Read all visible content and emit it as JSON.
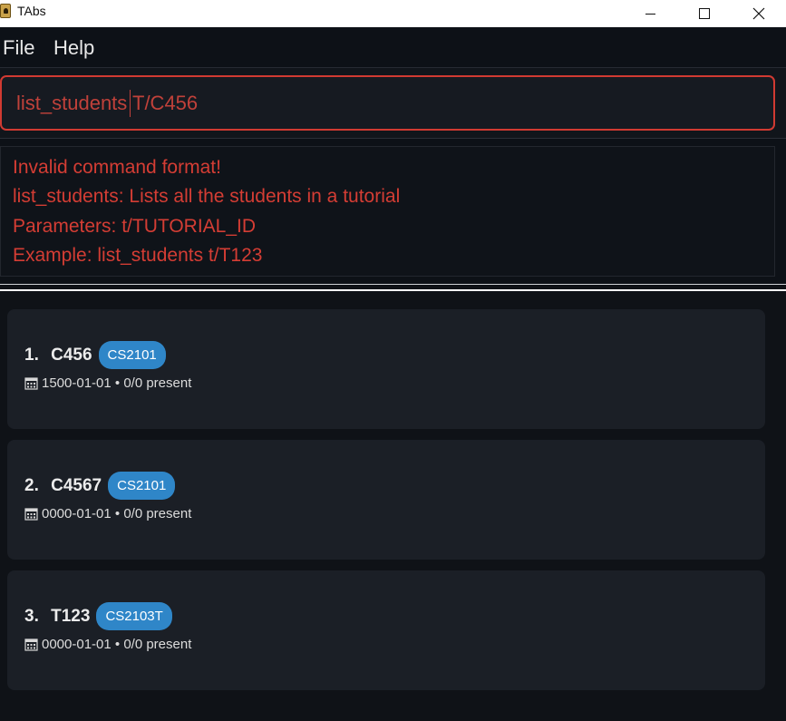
{
  "window": {
    "title": "TAbs"
  },
  "menu": {
    "file": "File",
    "help": "Help"
  },
  "command": {
    "value": "list_students T/C456"
  },
  "result": {
    "lines": [
      "Invalid command format!",
      "list_students: Lists all the students in a tutorial",
      "Parameters: t/TUTORIAL_ID",
      "Example: list_students t/T123"
    ]
  },
  "tutorials": [
    {
      "index": "1. ",
      "id": "C456",
      "tag": "CS2101",
      "meta": "1500-01-01 • 0/0 present"
    },
    {
      "index": "2. ",
      "id": "C4567",
      "tag": "CS2101",
      "meta": "0000-01-01 • 0/0 present"
    },
    {
      "index": "3. ",
      "id": "T123",
      "tag": "CS2103T",
      "meta": "0000-01-01 • 0/0 present"
    }
  ],
  "icons": {
    "app": "app-icon",
    "calendar": "calendar-icon"
  },
  "colors": {
    "error": "#d43d34",
    "tag": "#2f86c8",
    "card": "#1b1f26"
  }
}
